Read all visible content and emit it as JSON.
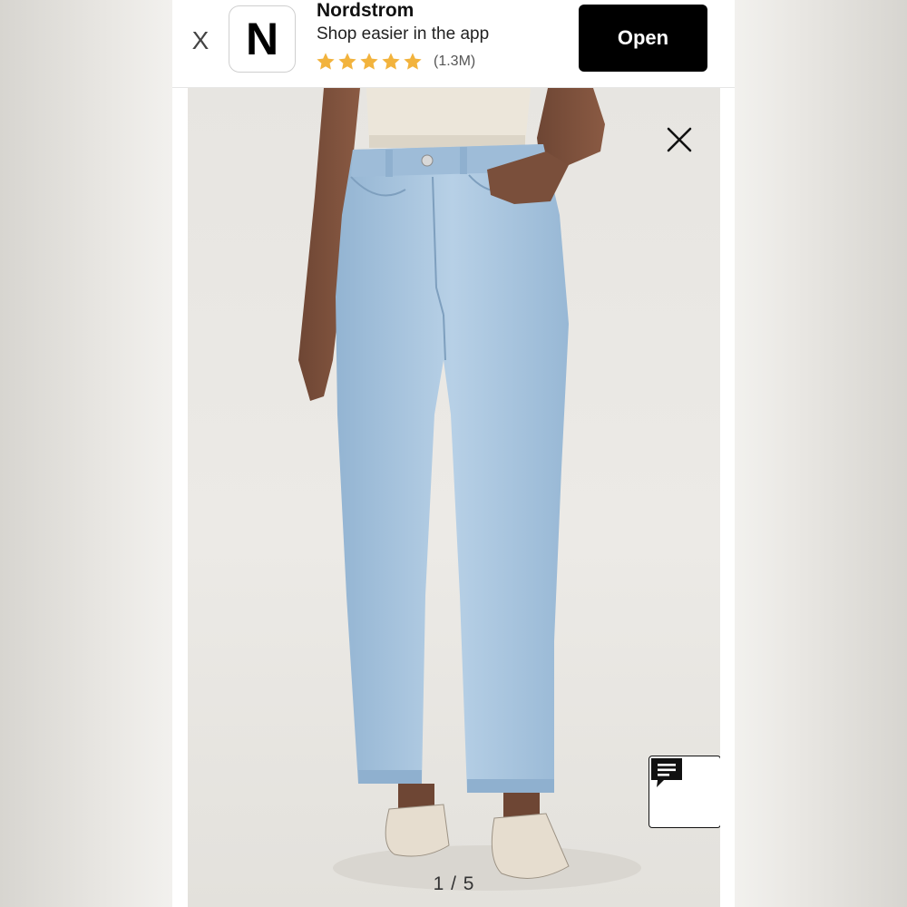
{
  "banner": {
    "close_label": "X",
    "app_icon_letter": "N",
    "app_name": "Nordstrom",
    "tagline": "Shop easier in the app",
    "rating_stars": 5,
    "rating_count": "(1.3M)",
    "open_label": "Open"
  },
  "gallery": {
    "page_indicator": "1 / 5",
    "current_index": 1,
    "total": 5,
    "image_icon": "model-wearing-light-wash-wide-leg-jeans"
  },
  "icons": {
    "close": "close-icon",
    "chat": "chat-icon",
    "star": "star-icon"
  },
  "colors": {
    "star": "#f2b33d",
    "open_button_bg": "#000000",
    "denim": "#a9c6df"
  }
}
